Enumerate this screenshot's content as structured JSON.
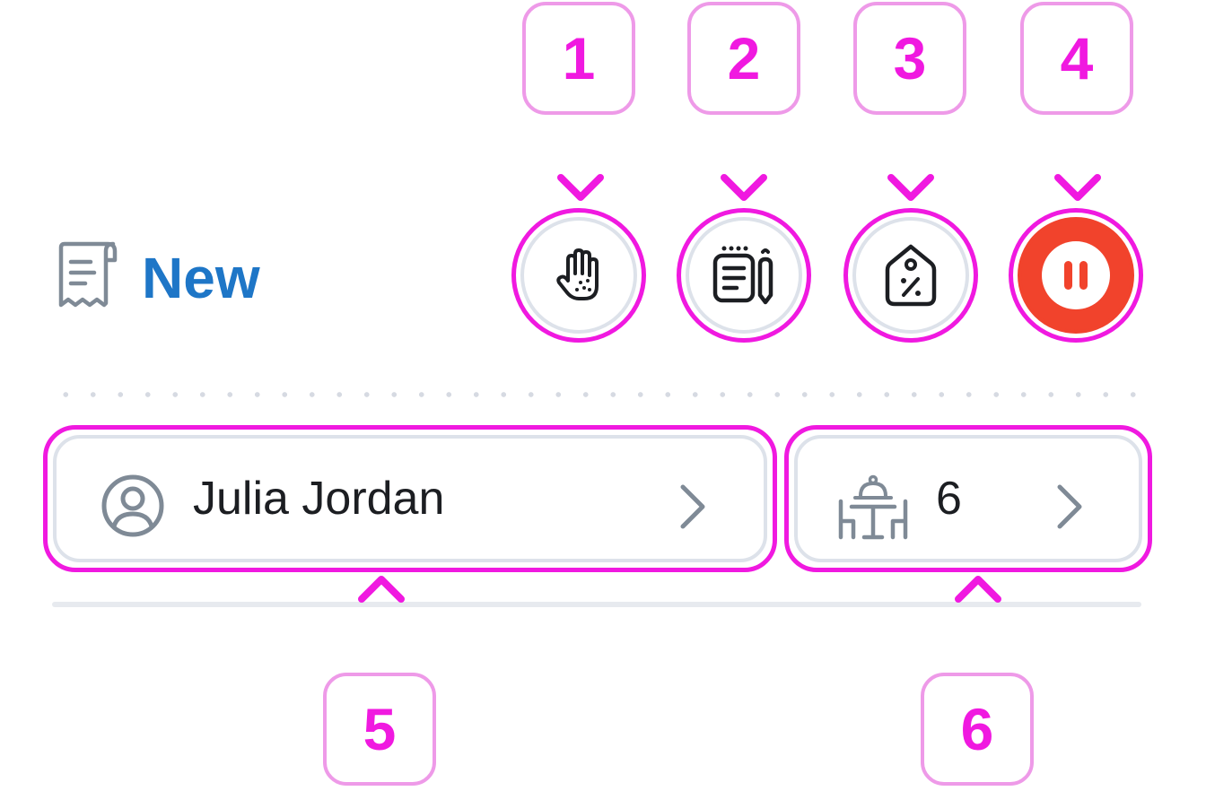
{
  "header": {
    "title": "New",
    "receipt_icon": "receipt-icon"
  },
  "actions": [
    {
      "id": "hold",
      "icon": "hand-icon"
    },
    {
      "id": "notes",
      "icon": "notes-pencil-icon"
    },
    {
      "id": "discount",
      "icon": "discount-tag-icon"
    },
    {
      "id": "pause",
      "icon": "pause-icon",
      "color": "#f1432c"
    }
  ],
  "customer": {
    "name": "Julia Jordan",
    "icon": "user-circle-icon"
  },
  "table": {
    "number": "6",
    "icon": "dining-table-icon"
  },
  "callouts": [
    "1",
    "2",
    "3",
    "4",
    "5",
    "6"
  ],
  "colors": {
    "accent": "#f019e0",
    "callout_border": "#ee9ae8",
    "title": "#1e76c7",
    "pause": "#f1432c"
  }
}
